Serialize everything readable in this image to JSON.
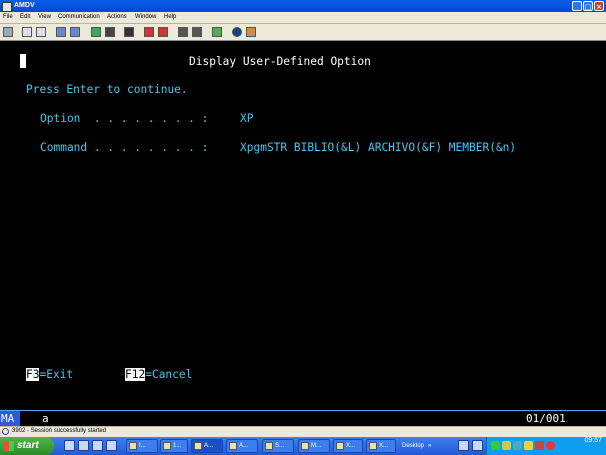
{
  "window": {
    "title": "AMDV",
    "btn_min": "_",
    "btn_max": "□",
    "btn_close": "×"
  },
  "menu": [
    "File",
    "Edit",
    "View",
    "Communication",
    "Actions",
    "Window",
    "Help"
  ],
  "toolbar_icons": [
    "print-icon",
    "copy-icon",
    "paste-icon",
    "send-icon",
    "receive-icon",
    "display-icon",
    "stop-icon",
    "record-icon",
    "play-macro-icon",
    "macro-icon",
    "settings-icon",
    "clipboard-icon",
    "help-icon",
    "edit-icon"
  ],
  "terminal": {
    "heading": "Display User-Defined Option",
    "instruction": "Press Enter to continue.",
    "option_label": "Option  . . . . . . . . :",
    "option_value": "XP",
    "command_label": "Command . . . . . . . . :",
    "command_value": "XpgmSTR BIBLIO(&L) ARCHIVO(&F) MEMBER(&n)",
    "fkeys": [
      {
        "key": "F3",
        "label": "=Exit"
      },
      {
        "key": "F12",
        "label": "=Cancel"
      }
    ]
  },
  "oia": {
    "session": "MA",
    "indicator": "a",
    "cursor_position": "01/001"
  },
  "status": {
    "text": "3902 - Session successfully started"
  },
  "taskbar": {
    "start_label": "start",
    "tasks": [
      "I...",
      "1...",
      "A...",
      "A...",
      "S...",
      "M...",
      "X...",
      "X..."
    ],
    "desktop_label": "Desktop",
    "desktop_marker": "»",
    "clock": "09:57"
  },
  "colors": {
    "screen_bg": "#000000",
    "field_text": "#45c8f0",
    "heading_text": "#ffffff",
    "titlebar": "#0a5ee8",
    "taskbar": "#2458d6",
    "start_button": "#3ea03a"
  }
}
